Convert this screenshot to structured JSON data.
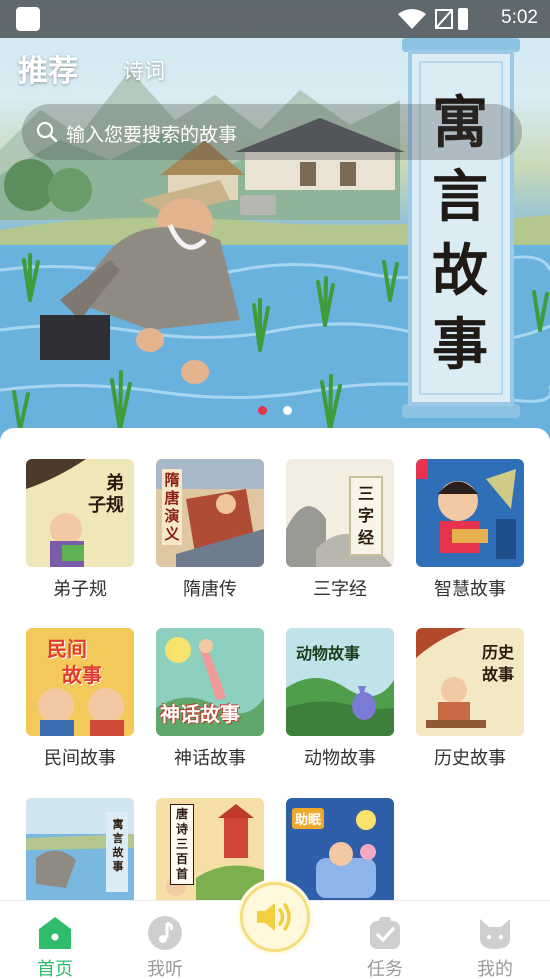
{
  "status_bar": {
    "time": "5:02"
  },
  "header": {
    "tabs": [
      {
        "label": "推荐",
        "active": true
      },
      {
        "label": "诗词",
        "active": false
      }
    ]
  },
  "search": {
    "placeholder": "输入您要搜索的故事"
  },
  "banner": {
    "scroll_title_chars": [
      "寓",
      "言",
      "故",
      "事"
    ],
    "carousel": {
      "count": 2,
      "active_index": 0
    }
  },
  "categories": [
    {
      "label": "弟子规",
      "cover_text": [
        "弟",
        "子规"
      ]
    },
    {
      "label": "隋唐传",
      "cover_text": [
        "隋唐演义"
      ]
    },
    {
      "label": "三字经",
      "cover_text": [
        "三",
        "字",
        "经"
      ]
    },
    {
      "label": "智慧故事",
      "cover_text": []
    },
    {
      "label": "民间故事",
      "cover_text": [
        "民间",
        "故事"
      ]
    },
    {
      "label": "神话故事",
      "cover_text": [
        "神话故事"
      ]
    },
    {
      "label": "动物故事",
      "cover_text": [
        "动物故事"
      ]
    },
    {
      "label": "历史故事",
      "cover_text": [
        "历史",
        "故事"
      ]
    },
    {
      "label": "",
      "cover_text": [
        "寓言",
        "故事"
      ]
    },
    {
      "label": "",
      "cover_text": [
        "唐诗",
        "三百首"
      ]
    },
    {
      "label": "",
      "cover_text": [
        "助眠"
      ]
    }
  ],
  "bottom_nav": {
    "items": [
      {
        "label": "首页",
        "icon": "home-icon",
        "active": true
      },
      {
        "label": "我听",
        "icon": "music-note-icon",
        "active": false
      },
      {
        "label": "任务",
        "icon": "task-check-icon",
        "active": false
      },
      {
        "label": "我的",
        "icon": "cat-face-icon",
        "active": false
      }
    ],
    "center_button_icon": "speaker-icon"
  },
  "colors": {
    "accent_green": "#2fbd6c",
    "inactive_gray": "#9a9a9a",
    "carousel_active": "#e8334f",
    "play_button_border": "#f5df7c"
  }
}
